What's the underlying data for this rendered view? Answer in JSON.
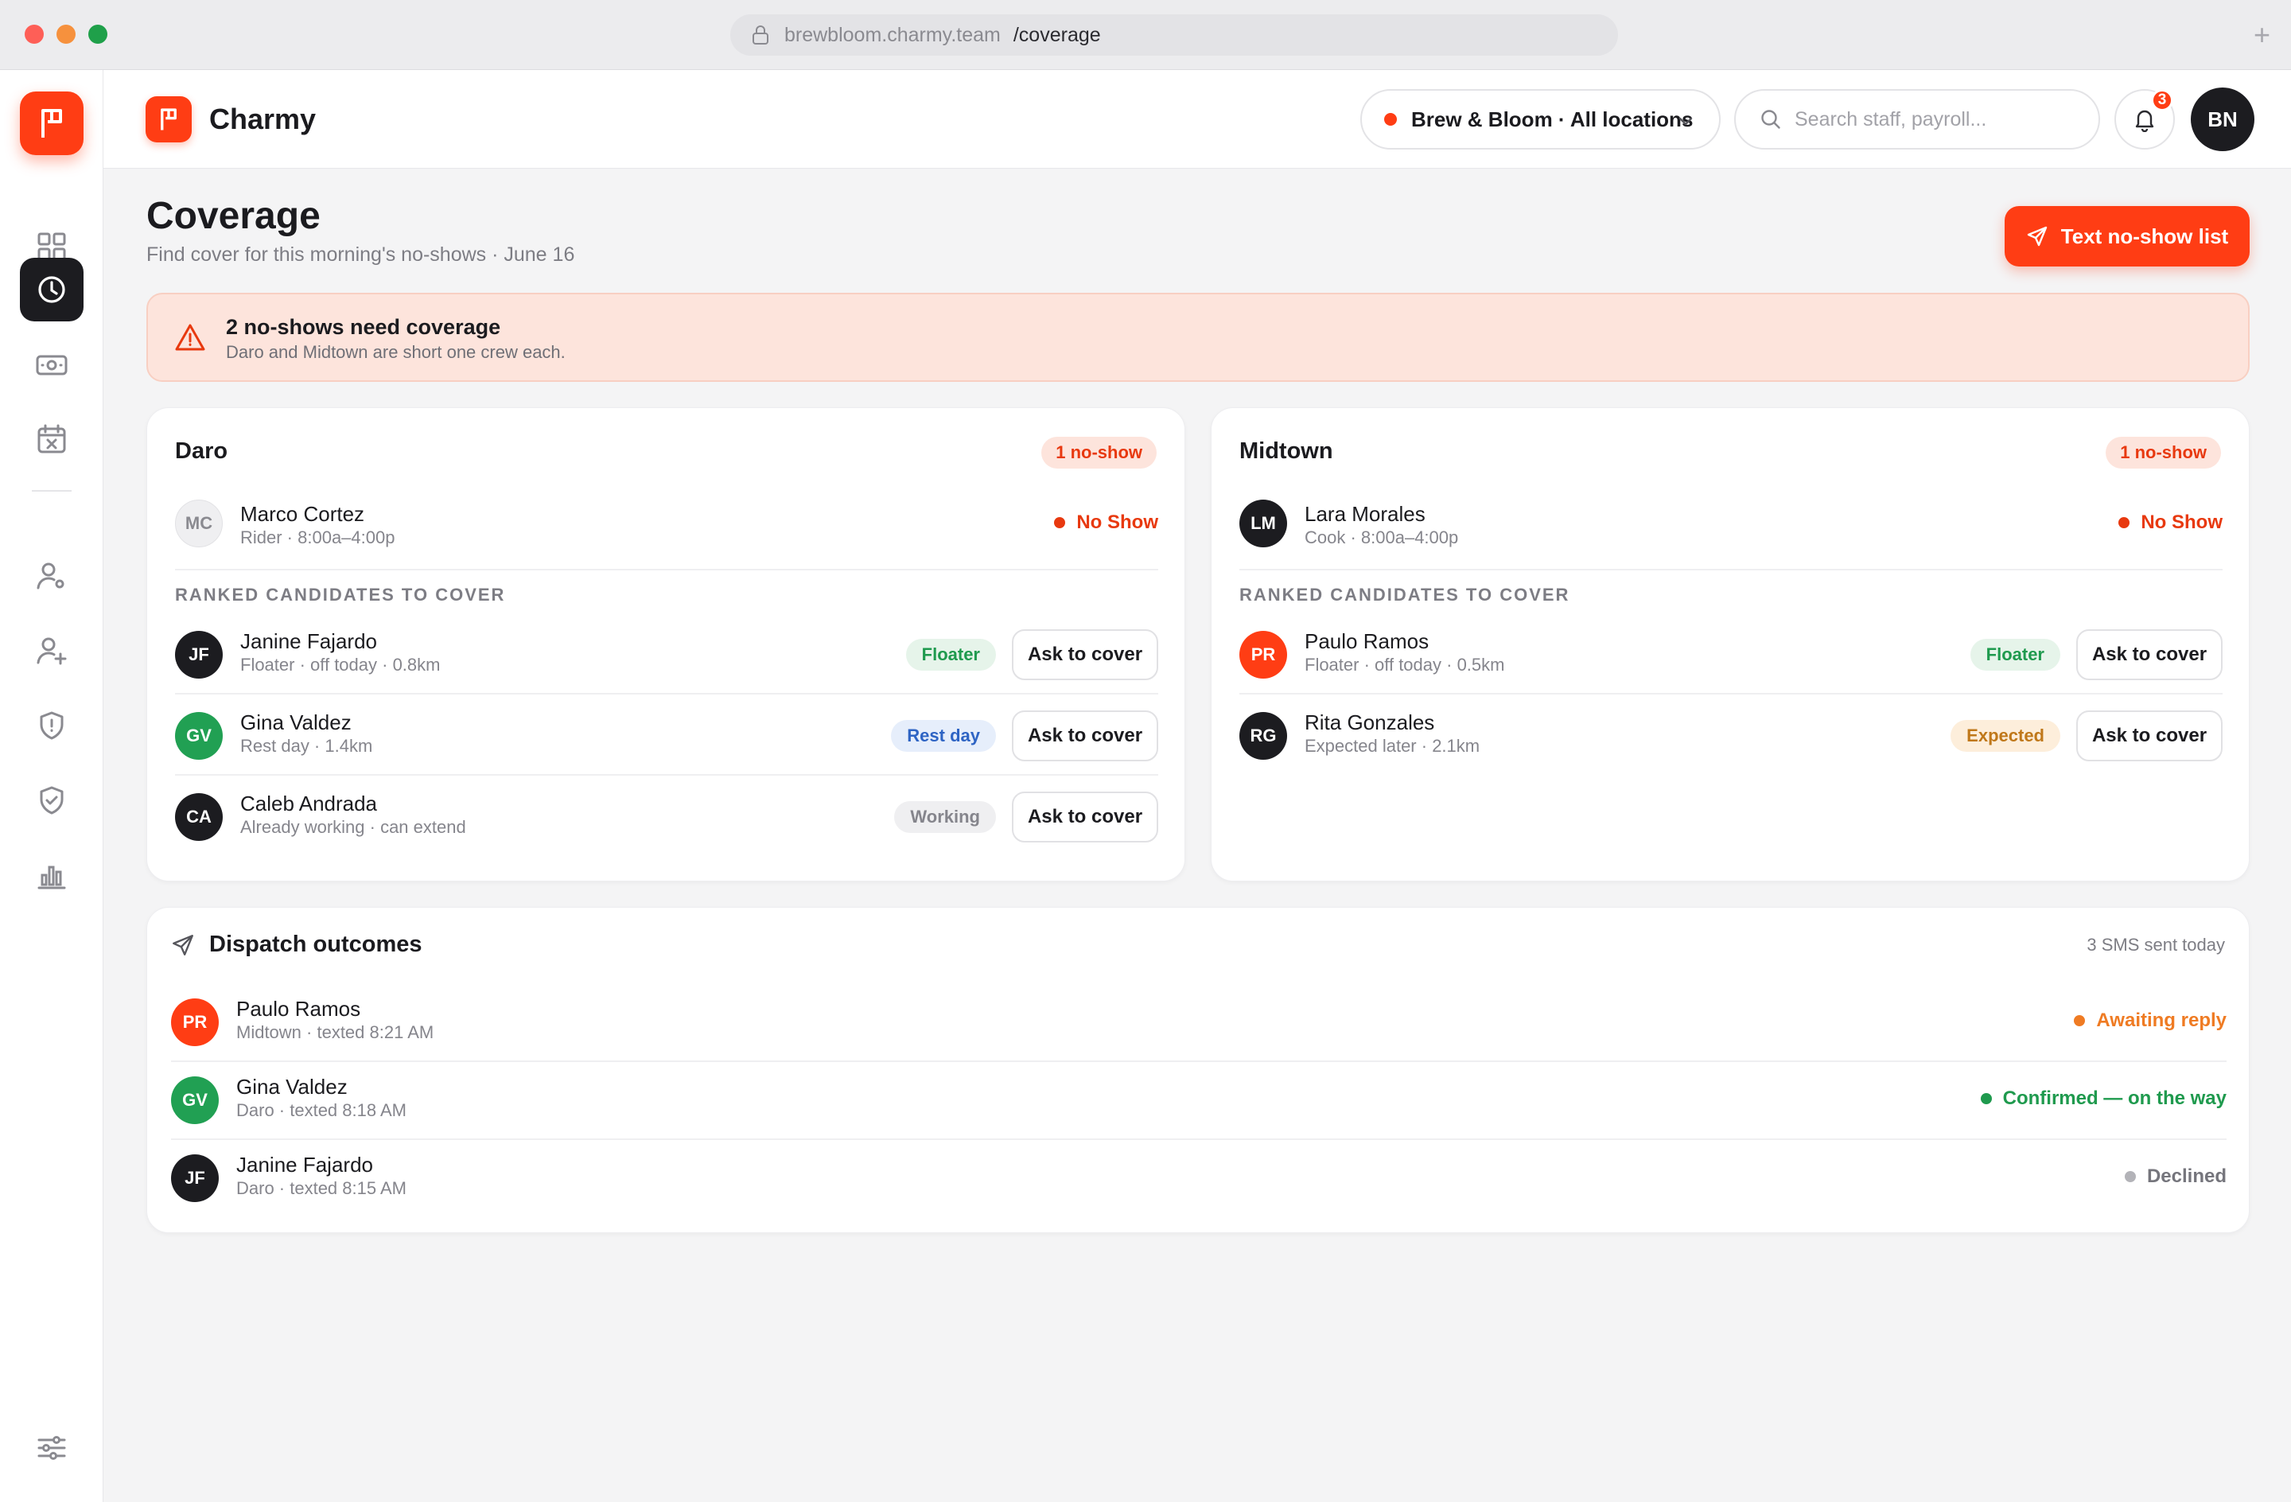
{
  "browser": {
    "url_host": "brewbloom.charmy.team",
    "url_path": "/coverage"
  },
  "brand": {
    "name": "Charmy",
    "color": "#ff3d14"
  },
  "sidebar": {
    "items": [
      {
        "icon": "grid-icon",
        "active": false
      },
      {
        "icon": "clock-icon",
        "active": true
      },
      {
        "icon": "cash-icon",
        "active": false
      },
      {
        "icon": "calendar-x-icon",
        "active": false
      },
      {
        "icon": "user-settings-icon",
        "active": false
      },
      {
        "icon": "user-plus-icon",
        "active": false
      },
      {
        "icon": "shield-alert-icon",
        "active": false
      },
      {
        "icon": "shield-check-icon",
        "active": false
      },
      {
        "icon": "bar-chart-icon",
        "active": false
      }
    ],
    "footer_icon": "sliders-icon"
  },
  "topbar": {
    "location": "Brew & Bloom · All locations",
    "search_placeholder": "Search staff, payroll...",
    "notifications": "3",
    "user_initials": "BN"
  },
  "page": {
    "title": "Coverage",
    "subtitle": "Find cover for this morning's no-shows · June 16",
    "primary_action": "Text no-show list"
  },
  "alert": {
    "title": "2 no-shows need coverage",
    "detail": "Daro and Midtown are short one crew each."
  },
  "locations": [
    {
      "name": "Daro",
      "badge": "1 no-show",
      "noshow": {
        "initials": "MC",
        "name": "Marco Cortez",
        "meta": "Rider · 8:00a–4:00p",
        "status": "No Show"
      },
      "section_label": "RANKED CANDIDATES TO COVER",
      "candidates": [
        {
          "initials": "JF",
          "name": "Janine Fajardo",
          "meta": "Floater · off today · 0.8km",
          "tag": "Floater",
          "action": "Ask to cover"
        },
        {
          "initials": "GV",
          "name": "Gina Valdez",
          "meta": "Rest day · 1.4km",
          "tag": "Rest day",
          "action": "Ask to cover"
        },
        {
          "initials": "CA",
          "name": "Caleb Andrada",
          "meta": "Already working · can extend",
          "tag": "Working",
          "action": "Ask to cover"
        }
      ]
    },
    {
      "name": "Midtown",
      "badge": "1 no-show",
      "noshow": {
        "initials": "LM",
        "name": "Lara Morales",
        "meta": "Cook · 8:00a–4:00p",
        "status": "No Show"
      },
      "section_label": "RANKED CANDIDATES TO COVER",
      "candidates": [
        {
          "initials": "PR",
          "name": "Paulo Ramos",
          "meta": "Floater · off today · 0.5km",
          "tag": "Floater",
          "action": "Ask to cover"
        },
        {
          "initials": "RG",
          "name": "Rita Gonzales",
          "meta": "Expected later · 2.1km",
          "tag": "Expected",
          "action": "Ask to cover"
        }
      ]
    }
  ],
  "dispatch": {
    "title": "Dispatch outcomes",
    "count": "3 SMS sent today",
    "rows": [
      {
        "initials": "PR",
        "name": "Paulo Ramos",
        "meta": "Midtown · texted 8:21 AM",
        "status": "Awaiting reply"
      },
      {
        "initials": "GV",
        "name": "Gina Valdez",
        "meta": "Daro · texted 8:18 AM",
        "status": "Confirmed — on the way"
      },
      {
        "initials": "JF",
        "name": "Janine Fajardo",
        "meta": "Daro · texted 8:15 AM",
        "status": "Declined"
      }
    ]
  }
}
